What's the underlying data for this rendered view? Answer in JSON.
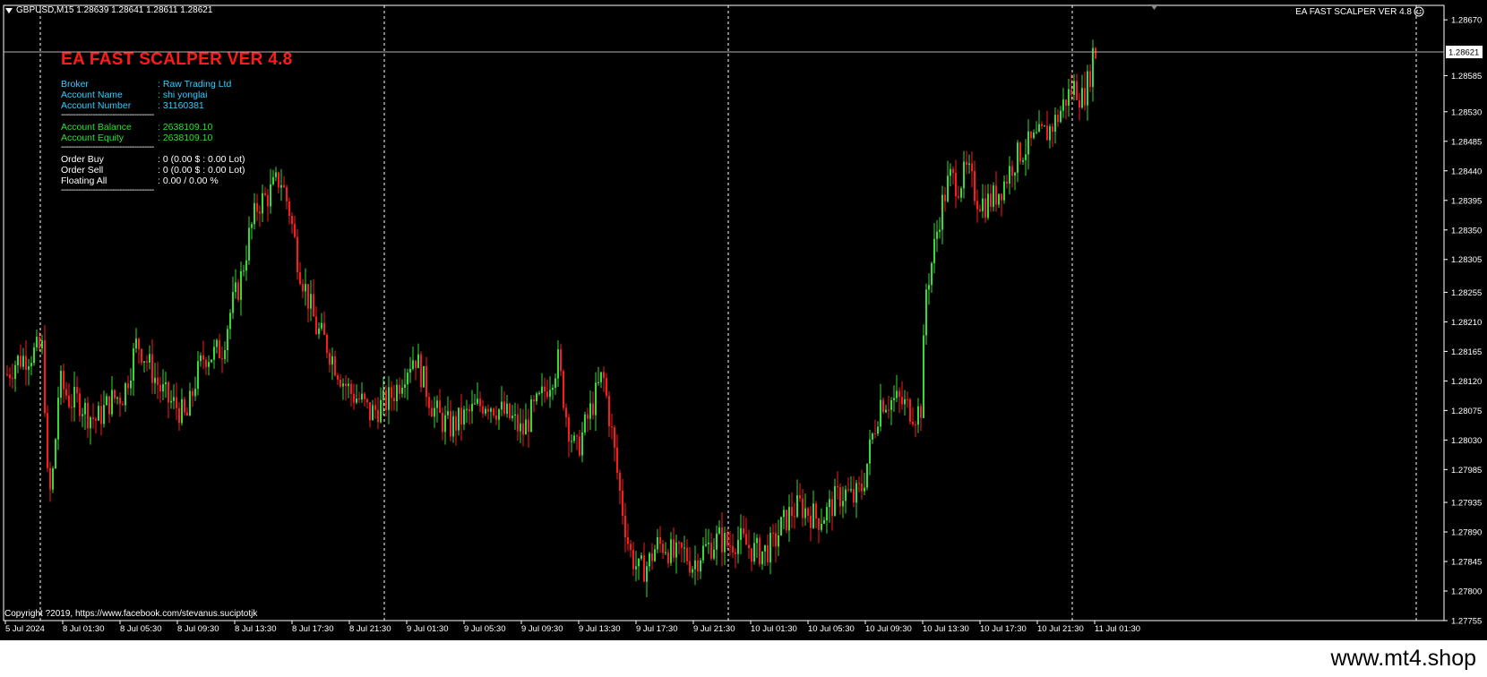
{
  "header": {
    "symbol_info": "GBPUSD,M15  1.28639 1.28641 1.28611 1.28621",
    "ea_name": "EA FAST SCALPER VER 4.8"
  },
  "panel": {
    "title": "EA FAST SCALPER VER 4.8",
    "broker_label": "Broker",
    "broker_value": ": Raw Trading Ltd",
    "account_name_label": "Account Name",
    "account_name_value": ": shi yonglai",
    "account_number_label": "Account Number",
    "account_number_value": ": 31160381",
    "separator": "--------------------------------------",
    "balance_label": "Account Balance",
    "balance_value": ": 2638109.10",
    "equity_label": "Account Equity",
    "equity_value": ": 2638109.10",
    "order_buy_label": "Order Buy",
    "order_buy_value": ": 0 (0.00 $ : 0.00 Lot)",
    "order_sell_label": "Order Sell",
    "order_sell_value": ": 0 (0.00 $ : 0.00 Lot)",
    "floating_label": "Floating All",
    "floating_value": ": 0.00 / 0.00 %"
  },
  "copyright": "Copyright ?2019, https://www.facebook.com/stevanus.suciptotjk",
  "watermark": "www.mt4.shop",
  "colors": {
    "bull": "#33dd33",
    "bear": "#ff1a1a",
    "background": "#000000",
    "axis": "#ffffff",
    "bid_line": "#b0b0b0"
  },
  "chart_data": {
    "type": "candlestick",
    "symbol": "GBPUSD",
    "timeframe": "M15",
    "ylim": [
      1.27755,
      1.28692
    ],
    "y_ticks": [
      "1.28670",
      "1.28585",
      "1.28530",
      "1.28485",
      "1.28440",
      "1.28395",
      "1.28350",
      "1.28305",
      "1.28255",
      "1.28210",
      "1.28165",
      "1.28120",
      "1.28075",
      "1.28030",
      "1.27985",
      "1.27935",
      "1.27890",
      "1.27845",
      "1.27800",
      "1.27755"
    ],
    "x_ticks": [
      "5 Jul 2024",
      "8 Jul 01:30",
      "8 Jul 05:30",
      "8 Jul 09:30",
      "8 Jul 13:30",
      "8 Jul 17:30",
      "8 Jul 21:30",
      "9 Jul 01:30",
      "9 Jul 05:30",
      "9 Jul 09:30",
      "9 Jul 13:30",
      "9 Jul 17:30",
      "9 Jul 21:30",
      "10 Jul 01:30",
      "10 Jul 05:30",
      "10 Jul 09:30",
      "10 Jul 13:30",
      "10 Jul 17:30",
      "10 Jul 21:30",
      "11 Jul 01:30"
    ],
    "current_price": "1.28621",
    "close_path": [
      [
        0,
        1.2813
      ],
      [
        10,
        1.2815
      ],
      [
        25,
        1.2816
      ],
      [
        40,
        1.2817
      ],
      [
        46,
        1.2793
      ],
      [
        52,
        1.2799
      ],
      [
        58,
        1.2812
      ],
      [
        70,
        1.2809
      ],
      [
        80,
        1.2809
      ],
      [
        90,
        1.2807
      ],
      [
        100,
        1.2806
      ],
      [
        115,
        1.2809
      ],
      [
        130,
        1.281
      ],
      [
        145,
        1.2818
      ],
      [
        160,
        1.2814
      ],
      [
        170,
        1.2811
      ],
      [
        180,
        1.2809
      ],
      [
        190,
        1.2808
      ],
      [
        200,
        1.2806
      ],
      [
        210,
        1.2812
      ],
      [
        220,
        1.2816
      ],
      [
        230,
        1.2816
      ],
      [
        240,
        1.2817
      ],
      [
        250,
        1.2823
      ],
      [
        260,
        1.2827
      ],
      [
        270,
        1.2834
      ],
      [
        280,
        1.2839
      ],
      [
        290,
        1.284
      ],
      [
        300,
        1.2842
      ],
      [
        305,
        1.2843
      ],
      [
        315,
        1.2838
      ],
      [
        325,
        1.283
      ],
      [
        335,
        1.2825
      ],
      [
        345,
        1.282
      ],
      [
        355,
        1.2818
      ],
      [
        365,
        1.2815
      ],
      [
        375,
        1.2812
      ],
      [
        385,
        1.281
      ],
      [
        395,
        1.2809
      ],
      [
        405,
        1.2807
      ],
      [
        415,
        1.2808
      ],
      [
        425,
        1.2809
      ],
      [
        435,
        1.2811
      ],
      [
        445,
        1.2814
      ],
      [
        455,
        1.2816
      ],
      [
        465,
        1.2812
      ],
      [
        475,
        1.2808
      ],
      [
        485,
        1.2806
      ],
      [
        495,
        1.2805
      ],
      [
        505,
        1.2806
      ],
      [
        515,
        1.2807
      ],
      [
        525,
        1.2808
      ],
      [
        535,
        1.2809
      ],
      [
        545,
        1.2808
      ],
      [
        555,
        1.2807
      ],
      [
        565,
        1.2806
      ],
      [
        575,
        1.2804
      ],
      [
        585,
        1.2807
      ],
      [
        595,
        1.2809
      ],
      [
        605,
        1.2812
      ],
      [
        615,
        1.2815
      ],
      [
        625,
        1.2806
      ],
      [
        635,
        1.2801
      ],
      [
        645,
        1.2805
      ],
      [
        655,
        1.2809
      ],
      [
        665,
        1.2813
      ],
      [
        675,
        1.2804
      ],
      [
        685,
        1.2794
      ],
      [
        695,
        1.2786
      ],
      [
        705,
        1.2783
      ],
      [
        715,
        1.2784
      ],
      [
        725,
        1.2787
      ],
      [
        735,
        1.2787
      ],
      [
        745,
        1.2785
      ],
      [
        755,
        1.2786
      ],
      [
        765,
        1.2784
      ],
      [
        775,
        1.2786
      ],
      [
        785,
        1.2787
      ],
      [
        795,
        1.2788
      ],
      [
        805,
        1.2787
      ],
      [
        815,
        1.2788
      ],
      [
        825,
        1.2787
      ],
      [
        835,
        1.2786
      ],
      [
        845,
        1.2786
      ],
      [
        855,
        1.2787
      ],
      [
        865,
        1.279
      ],
      [
        875,
        1.2792
      ],
      [
        885,
        1.2793
      ],
      [
        895,
        1.2792
      ],
      [
        905,
        1.2791
      ],
      [
        915,
        1.2792
      ],
      [
        925,
        1.2794
      ],
      [
        935,
        1.2795
      ],
      [
        945,
        1.2794
      ],
      [
        955,
        1.2796
      ],
      [
        965,
        1.2803
      ],
      [
        975,
        1.2809
      ],
      [
        985,
        1.2809
      ],
      [
        995,
        1.2809
      ],
      [
        1005,
        1.2808
      ],
      [
        1015,
        1.2807
      ],
      [
        1020,
        1.2808
      ],
      [
        1026,
        1.2826
      ],
      [
        1032,
        1.283
      ],
      [
        1042,
        1.2838
      ],
      [
        1052,
        1.2843
      ],
      [
        1062,
        1.2842
      ],
      [
        1072,
        1.2844
      ],
      [
        1082,
        1.284
      ],
      [
        1092,
        1.2839
      ],
      [
        1102,
        1.284
      ],
      [
        1112,
        1.2842
      ],
      [
        1122,
        1.2845
      ],
      [
        1132,
        1.2847
      ],
      [
        1142,
        1.2848
      ],
      [
        1152,
        1.2849
      ],
      [
        1162,
        1.285
      ],
      [
        1172,
        1.2852
      ],
      [
        1182,
        1.2855
      ],
      [
        1192,
        1.2857
      ],
      [
        1200,
        1.2855
      ],
      [
        1208,
        1.2858
      ],
      [
        1212,
        1.2862
      ],
      [
        1216,
        1.2862
      ]
    ]
  }
}
